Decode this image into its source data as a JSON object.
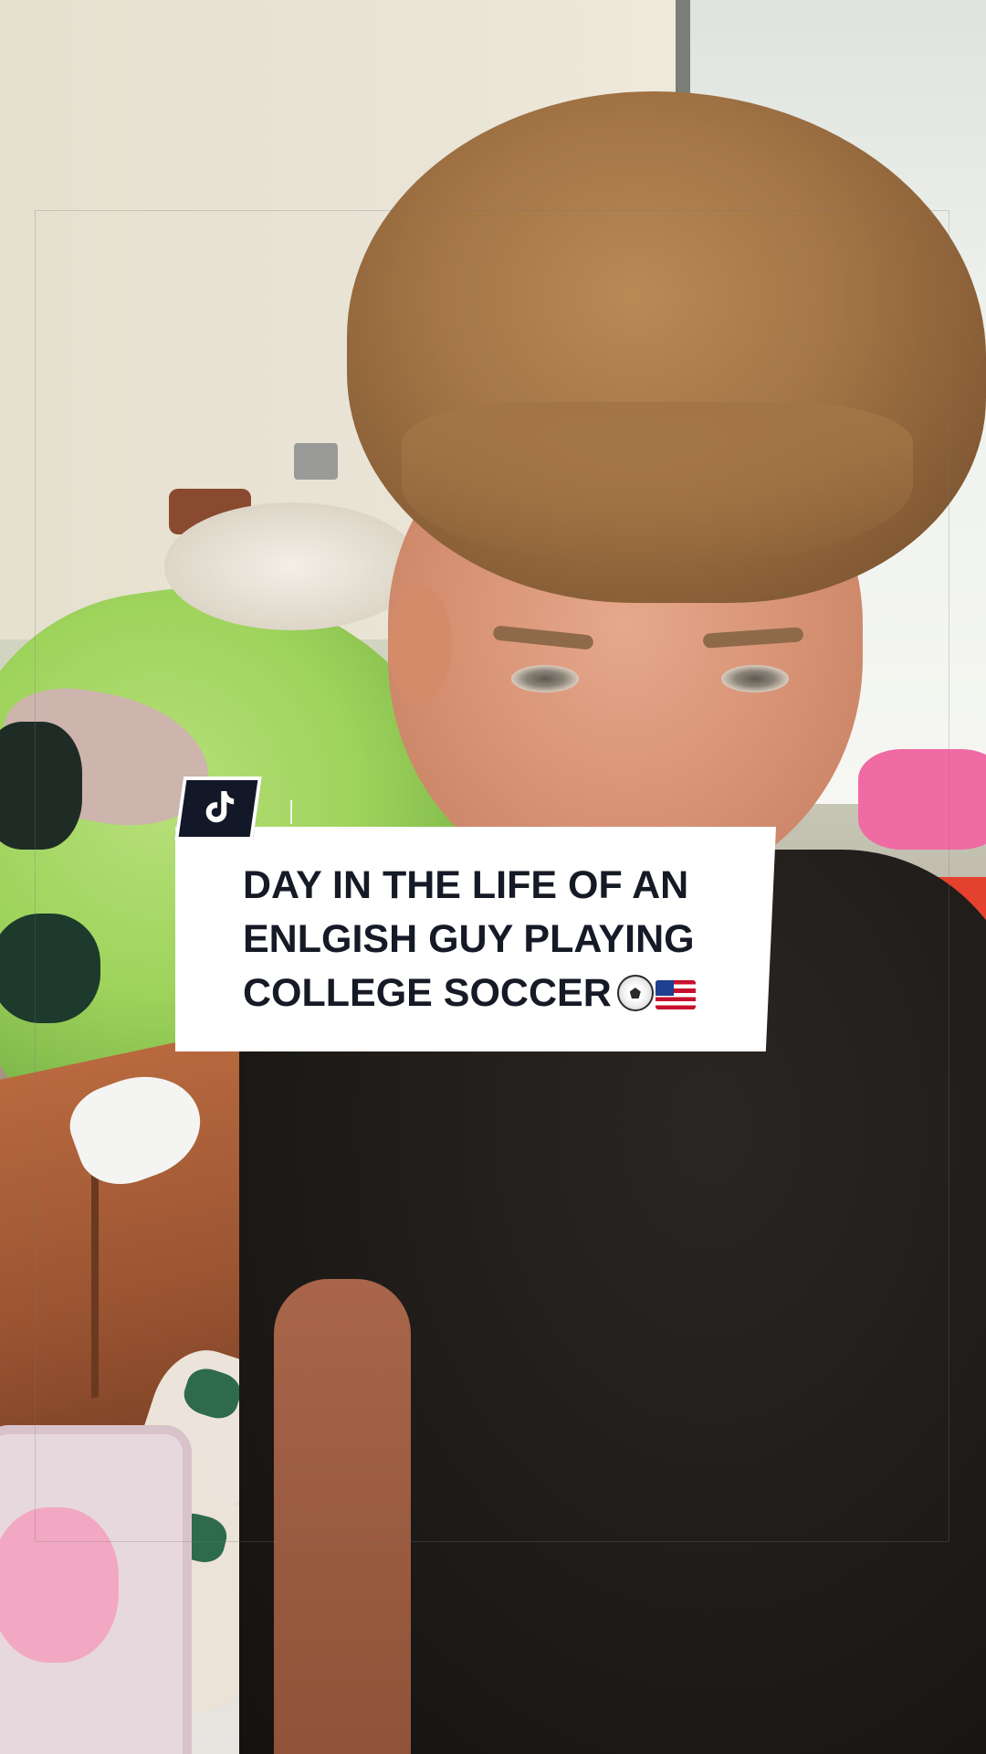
{
  "app": {
    "brand_icon": "tiktok-logo-icon"
  },
  "caption": {
    "line1": "DAY IN THE LIFE OF AN",
    "line2": "ENLGISH GUY PLAYING",
    "line3": "COLLEGE SOCCER",
    "emojis": [
      "soccer-ball-icon",
      "us-flag-icon"
    ]
  },
  "colors": {
    "caption_text": "#161a26",
    "caption_background": "#ffffff",
    "badge_background": "#131828"
  }
}
